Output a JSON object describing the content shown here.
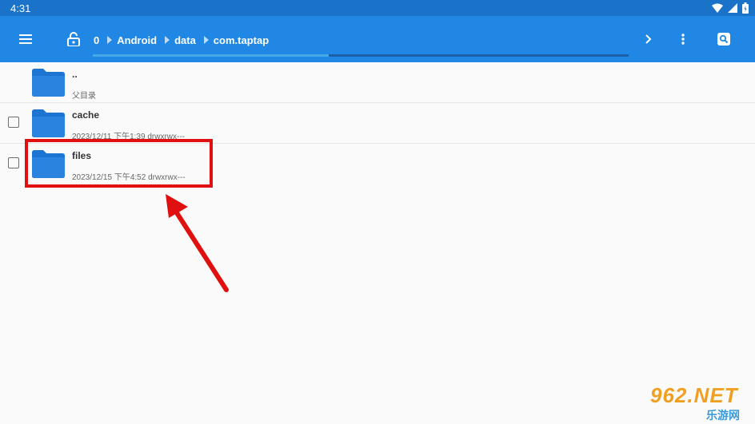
{
  "status_bar": {
    "time": "4:31"
  },
  "breadcrumb": [
    {
      "label": "0"
    },
    {
      "label": "Android"
    },
    {
      "label": "data"
    },
    {
      "label": "com.taptap"
    }
  ],
  "progress": {
    "fraction": 0.44
  },
  "file_list": [
    {
      "name": "..",
      "meta": "父目录",
      "checkbox": false
    },
    {
      "name": "cache",
      "meta": "2023/12/11 下午1:39   drwxrwx---",
      "checkbox": true
    },
    {
      "name": "files",
      "meta": "2023/12/15 下午4:52   drwxrwx---",
      "checkbox": true
    }
  ],
  "watermark": {
    "text": "962.NET",
    "sub": "乐游网"
  },
  "icons": {
    "menu": "menu-icon",
    "lock": "lock-icon",
    "forward": "chevron-right-icon",
    "more": "more-vert-icon",
    "search": "search-icon",
    "folder": "folder-icon"
  },
  "colors": {
    "toolbar": "#2088e4",
    "status_bar": "#1a73c9",
    "folder": "#1e74d2",
    "highlight": "#e01010"
  }
}
